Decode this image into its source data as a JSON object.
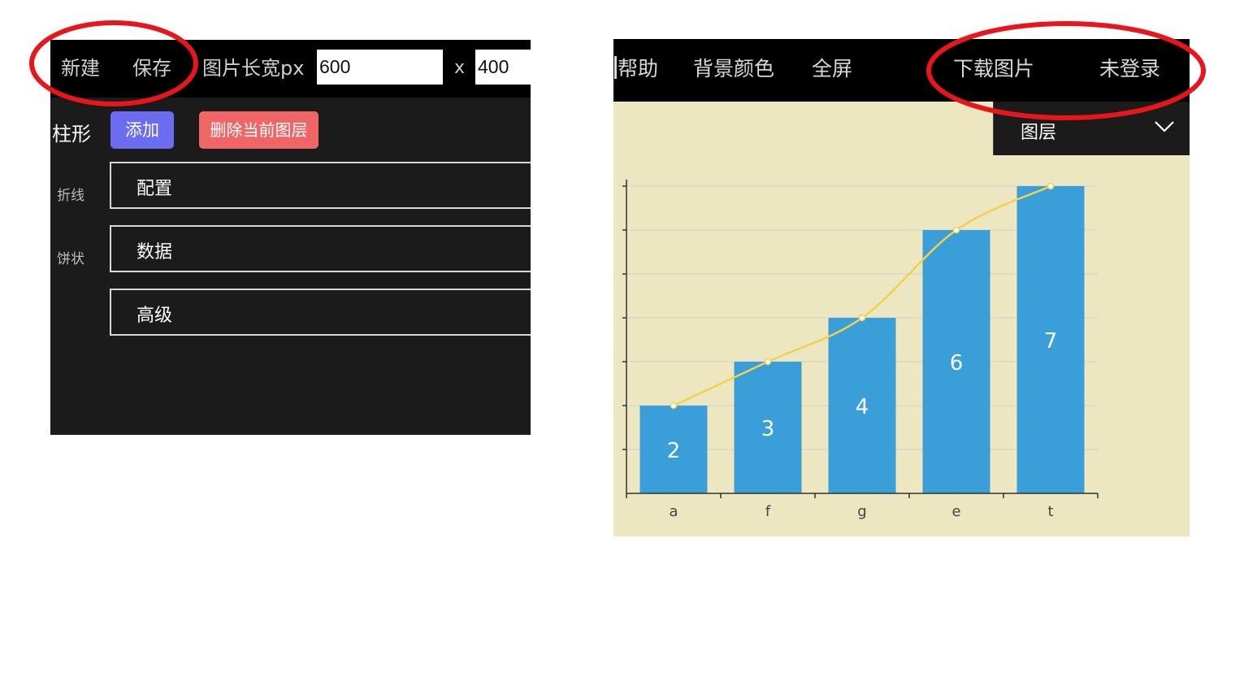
{
  "left_toolbar": {
    "new_label": "新建",
    "save_label": "保存",
    "size_label": "图片长宽px",
    "width_value": "600",
    "times_label": "x",
    "height_value": "400"
  },
  "chart_types": {
    "active": "柱形",
    "line": "折线",
    "pie": "饼状"
  },
  "layer_actions": {
    "add_label": "添加",
    "delete_label": "删除当前图层"
  },
  "panels": {
    "config": "配置",
    "data": "数据",
    "advanced": "高级"
  },
  "right_toolbar": {
    "help_label": "帮助",
    "bg_color_label": "背景颜色",
    "fullscreen_label": "全屏",
    "download_label": "下载图片",
    "login_label": "未登录"
  },
  "layer_dropdown": {
    "label": "图层"
  },
  "colors": {
    "bar": "#3a9fd8",
    "line": "#f5d04a",
    "chart_bg": "#ece7c0",
    "annotation": "#e8151b"
  },
  "chart_data": {
    "type": "bar",
    "categories": [
      "a",
      "f",
      "g",
      "e",
      "t"
    ],
    "series": [
      {
        "type": "bar",
        "values": [
          2,
          3,
          4,
          6,
          7
        ]
      },
      {
        "type": "line",
        "values": [
          2,
          3,
          4,
          6,
          7
        ]
      }
    ],
    "ylim": [
      0,
      7
    ],
    "grid": true,
    "data_labels": true
  }
}
